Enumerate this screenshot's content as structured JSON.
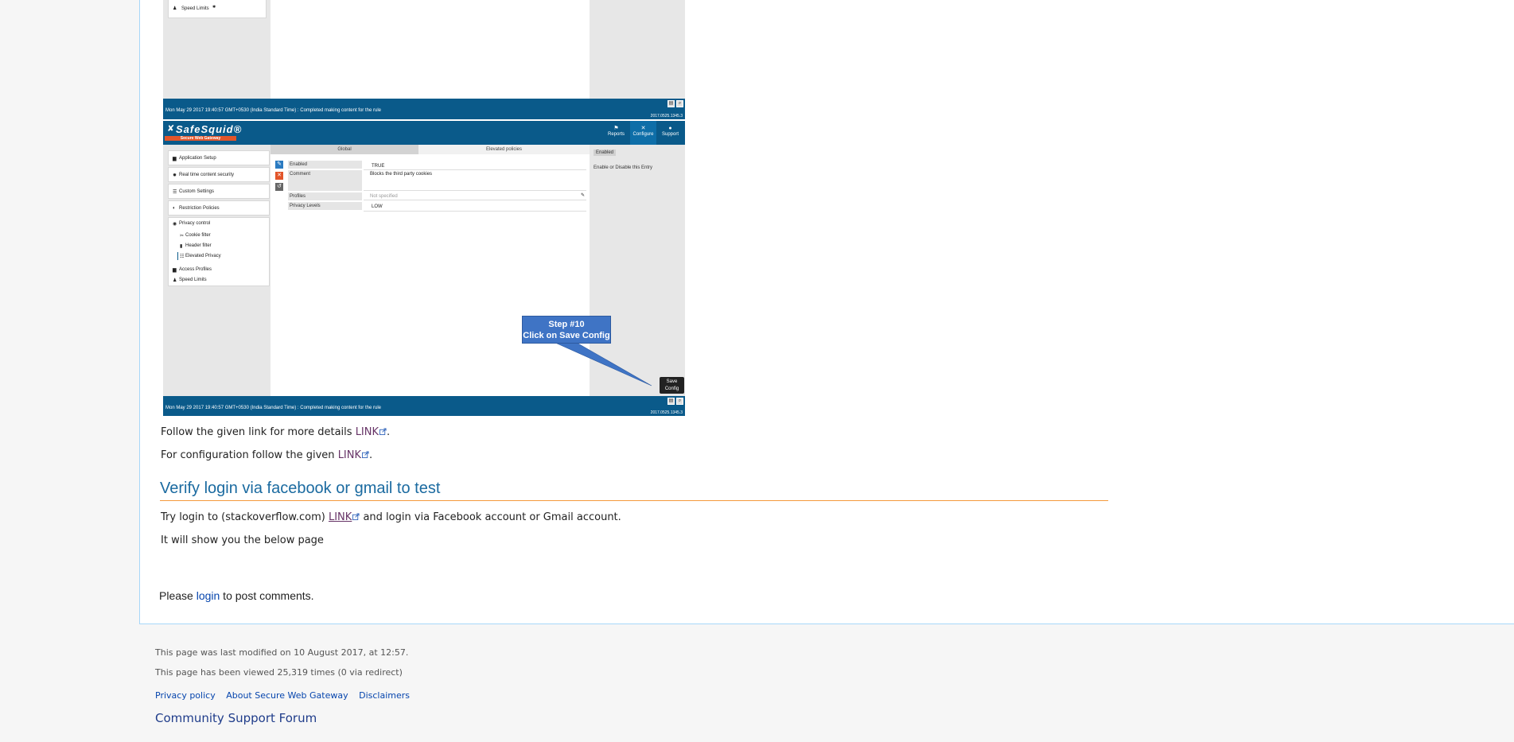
{
  "screenshot_top": {
    "side_item": "Speed Limits",
    "status_text": "Mon May 29 2017 19:40:57 GMT+0530 (India Standard Time) : Completed making content for the rule",
    "version": "2017.0525.1345.3"
  },
  "screenshot_main": {
    "brand": "SafeSquid®",
    "brand_tagline": "Secure Web Gateway",
    "nav": [
      {
        "label": "Reports",
        "icon": "⚑"
      },
      {
        "label": "Configure",
        "icon": "✕"
      },
      {
        "label": "Support",
        "icon": "●"
      }
    ],
    "tabs": [
      "Global",
      "Elevated policies"
    ],
    "menu": {
      "application_setup": "Application Setup",
      "realtime_security": "Real time content security",
      "custom_settings": "Custom Settings",
      "restriction_policies": "Restriction Policies",
      "privacy_control": "Privacy control",
      "cookie_filter": "Cookie filter",
      "header_filter": "Header filter",
      "elevated_privacy": "Elevated Privacy",
      "access_profiles": "Access Profiles",
      "speed_limits": "Speed Limits"
    },
    "fields": {
      "enabled_label": "Enabled",
      "enabled_value": "TRUE",
      "comment_label": "Comment",
      "comment_value": "Blocks the third party cookies",
      "profiles_label": "Profiles",
      "profiles_value": "Not specified",
      "privacy_label": "Privacy Levels",
      "privacy_value": "LOW"
    },
    "right_tag": "Enabled",
    "right_help": "Enable or Disable this Entry",
    "callout_line1": "Step #10",
    "callout_line2": "Click on Save Config",
    "save_line1": "Save",
    "save_line2": "Config",
    "status_text": "Mon May 29 2017 19:40:57 GMT+0530 (India Standard Time) : Completed making content for the rule",
    "version": "2017.0525.1345.3"
  },
  "article": {
    "p1_text": "Follow the given link for more details ",
    "p1_link": "LINK",
    "p2_text": "For configuration follow the given ",
    "p2_link": "LINK",
    "heading": "Verify login via facebook or gmail to test",
    "p3_before": "Try login to (stackoverflow.com) ",
    "p3_link": "LINK",
    "p3_after": "  and login via Facebook account or Gmail account.",
    "p4": "It will show you the below page",
    "period": "."
  },
  "comments": {
    "before": "Please ",
    "login_link": "login",
    "after": " to post comments."
  },
  "footer": {
    "last_modified": "This page was last modified on 10 August 2017, at 12:57.",
    "views": "This page has been viewed 25,319 times (0 via redirect)",
    "links": [
      "Privacy policy",
      "About Secure Web Gateway",
      "Disclaimers"
    ],
    "forum": "Community Support Forum"
  },
  "colors": {
    "brand_blue": "#0a5a8a",
    "heading_blue": "#1a6aa0",
    "heading_rule": "#f59a3c",
    "link_visited": "#663366",
    "link": "#0645ad",
    "callout": "#3f74c5"
  }
}
